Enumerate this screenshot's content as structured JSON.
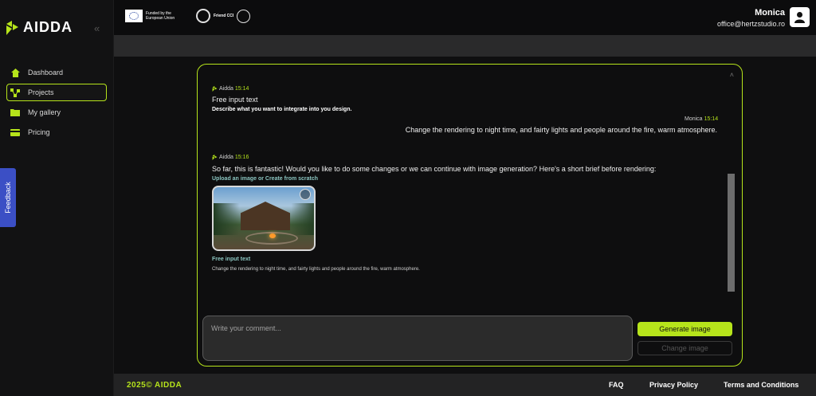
{
  "app": {
    "brand": "AIDDA"
  },
  "sidebar": {
    "items": [
      {
        "label": "Dashboard",
        "icon": "home-icon"
      },
      {
        "label": "Projects",
        "icon": "projects-icon",
        "active": true
      },
      {
        "label": "My gallery",
        "icon": "folder-icon"
      },
      {
        "label": "Pricing",
        "icon": "card-icon"
      }
    ],
    "feedback_label": "Feedback"
  },
  "header": {
    "eu_text": "Funded by the European Union",
    "friend_text": "Friend CCI",
    "user_name": "Monica",
    "user_email": "office@hertzstudio.ro"
  },
  "chat": {
    "messages": [
      {
        "sender": "Aidda",
        "time": "15:14",
        "title": "Free input text",
        "subtitle": "Describe what you want to integrate into you design."
      },
      {
        "sender": "Monica",
        "time": "15:14",
        "text": "Change the rendering to night time, and fairty lights and people around the fire, warm atmosphere."
      },
      {
        "sender": "Aidda",
        "time": "15:16",
        "text": "So far, this is fantastic! Would you like to do some changes or we can continue with image generation? Here's a short brief before rendering:",
        "section1": "Upload an image or Create from scratch",
        "section2": "Free input text",
        "section2_text": "Change the rendering to night time, and fairty lights and people around the fire, warm atmosphere."
      }
    ],
    "comment_placeholder": "Write your comment...",
    "generate_label": "Generate image",
    "change_label": "Change image"
  },
  "footer": {
    "copyright": "2025© AIDDA",
    "links": [
      "FAQ",
      "Privacy Policy",
      "Terms and Conditions"
    ]
  },
  "colors": {
    "accent": "#b6e41b",
    "background": "#0f0f10",
    "feedback": "#3b4fc5"
  }
}
